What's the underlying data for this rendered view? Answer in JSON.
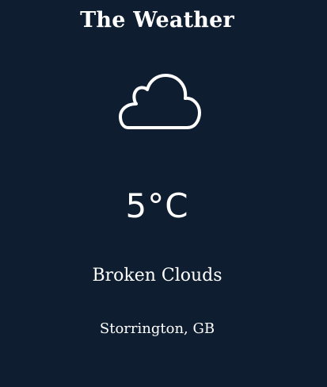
{
  "app": {
    "title": "The Weather"
  },
  "weather": {
    "icon": "cloud-icon",
    "temperature": "5°C",
    "condition": "Broken Clouds",
    "location": "Storrington, GB"
  },
  "colors": {
    "background": "#0e1d30",
    "text": "#ffffff"
  }
}
